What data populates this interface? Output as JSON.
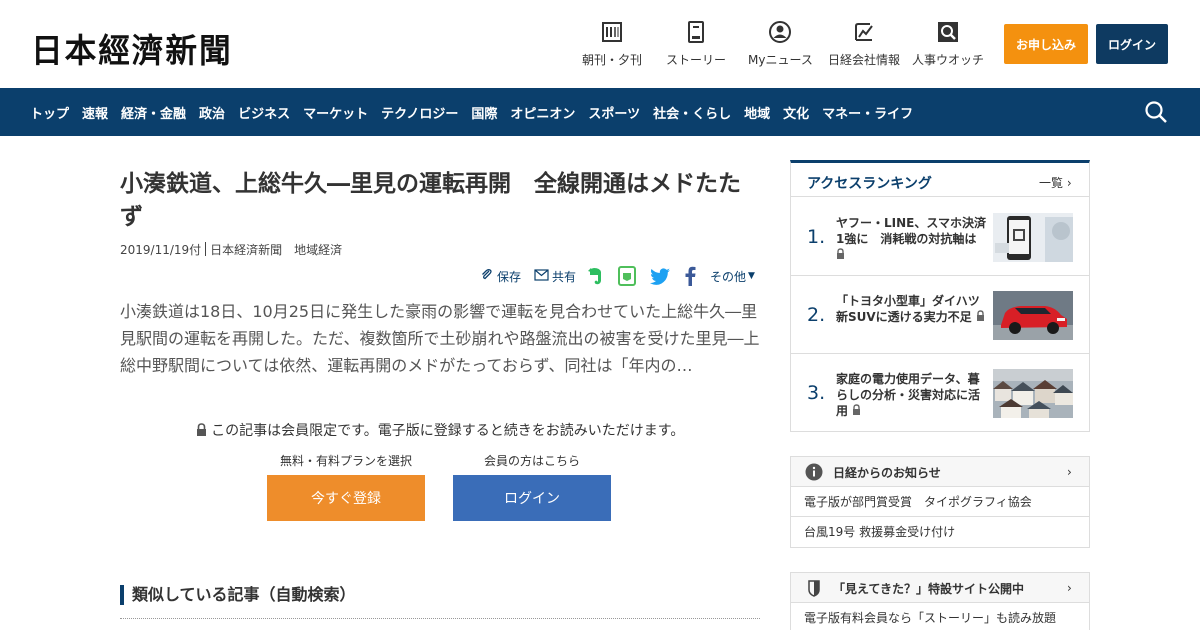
{
  "header": {
    "logo": "日本經濟新聞",
    "nav": [
      {
        "label": "朝刊・夕刊",
        "icon": "newspaper-icon"
      },
      {
        "label": "ストーリー",
        "icon": "story-icon"
      },
      {
        "label": "Myニュース",
        "icon": "user-icon"
      },
      {
        "label": "日経会社情報",
        "icon": "chart-icon"
      },
      {
        "label": "人事ウオッチ",
        "icon": "magnifier-icon"
      }
    ],
    "apply_label": "お申し込み",
    "login_label": "ログイン"
  },
  "navbar": {
    "items": [
      "トップ",
      "速報",
      "経済・金融",
      "政治",
      "ビジネス",
      "マーケット",
      "テクノロジー",
      "国際",
      "オピニオン",
      "スポーツ",
      "社会・くらし",
      "地域",
      "文化",
      "マネー・ライフ"
    ]
  },
  "article": {
    "headline": "小湊鉄道、上総牛久―里見の運転再開　全線開通はメドたたず",
    "date": "2019/11/19付",
    "source": "日本経済新聞　地域経済",
    "share": {
      "save": "保存",
      "share": "共有",
      "more": "その他"
    },
    "lead": "小湊鉄道は18日、10月25日に発生した豪雨の影響で運転を見合わせていた上総牛久―里見駅間の運転を再開した。ただ、複数箇所で土砂崩れや路盤流出の被害を受けた里見―上総中野駅間については依然、運転再開のメドがたっておらず、同社は「年内の…",
    "locked_notice": "この記事は会員限定です。電子版に登録すると続きをお読みいただけます。",
    "plan_label": "無料・有料プランを選択",
    "member_label": "会員の方はこちら",
    "register_button": "今すぐ登録",
    "login_button": "ログイン",
    "similar_heading": "類似している記事（自動検索）"
  },
  "ranking": {
    "title": "アクセスランキング",
    "more": "一覧",
    "items": [
      {
        "num": "1.",
        "text": "ヤフー・LINE、スマホ決済1強に　消耗戦の対抗軸は"
      },
      {
        "num": "2.",
        "text": "「トヨタ小型車」ダイハツ　新SUVに透ける実力不足"
      },
      {
        "num": "3.",
        "text": "家庭の電力使用データ、暮らしの分析・災害対応に活用"
      }
    ]
  },
  "notices": {
    "title": "日経からのお知らせ",
    "rows": [
      "電子版が部門賞受賞　タイポグラフィ協会",
      "台風19号 救援募金受け付け"
    ]
  },
  "promo": {
    "title": "「見えてきた？」特設サイト公開中",
    "rows": [
      "電子版有料会員なら「ストーリー」も読み放題"
    ]
  },
  "colors": {
    "navy": "#0b3f6c",
    "orange": "#f4910f",
    "login_blue": "#3a6db8"
  }
}
